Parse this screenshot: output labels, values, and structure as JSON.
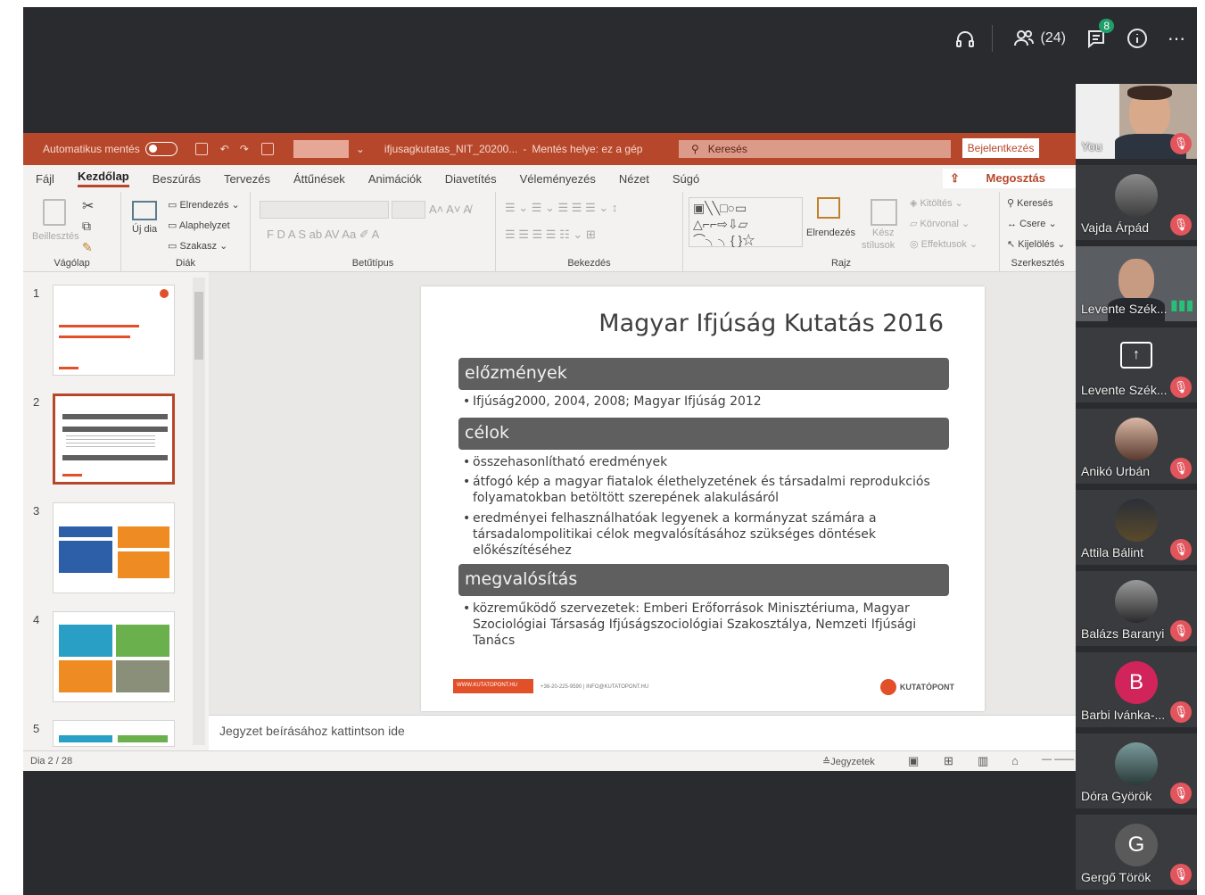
{
  "meeting": {
    "participants_count": "(24)",
    "chat_badge": "8"
  },
  "ppt": {
    "autosave_label": "Automatikus mentés",
    "file_title": "ifjusagkutatas_NIT_20200...",
    "save_location": "Mentés helye: ez a gép",
    "search_placeholder": "Keresés",
    "signin_label": "Bejelentkezés",
    "share_label": "Megosztás",
    "menu": [
      "Fájl",
      "Kezdőlap",
      "Beszúrás",
      "Tervezés",
      "Áttűnések",
      "Animációk",
      "Diavetítés",
      "Véleményezés",
      "Nézet",
      "Súgó"
    ],
    "ribbon": {
      "paste": "Beillesztés",
      "clipboard_group": "Vágólap",
      "new_slide": "Új dia",
      "layout": "Elrendezés",
      "reset": "Alaphelyzet",
      "section": "Szakasz",
      "slides_group": "Diák",
      "font_group": "Betűtípus",
      "paragraph_group": "Bekezdés",
      "arrange": "Elrendezés",
      "quick_styles_1": "Kész",
      "quick_styles_2": "stílusok",
      "fill": "Kitöltés",
      "outline": "Körvonal",
      "effects": "Effektusok",
      "drawing_group": "Rajz",
      "find": "Keresés",
      "replace": "Csere",
      "select": "Kijelölés",
      "editing_group": "Szerkesztés"
    },
    "thumb_numbers": [
      "1",
      "2",
      "3",
      "4",
      "5"
    ],
    "notes_placeholder": "Jegyzet beírásához kattintson ide",
    "status_slide": "Dia 2 / 28",
    "notes_button": "Jegyzetek"
  },
  "slide": {
    "title": "Magyar Ifjúság Kutatás 2016",
    "sections": [
      {
        "heading": "előzmények",
        "bullets": [
          "Ifjúság2000, 2004, 2008; Magyar Ifjúság 2012"
        ]
      },
      {
        "heading": "célok",
        "bullets": [
          "összehasonlítható eredmények",
          "átfogó kép a magyar fiatalok élethelyzetének és társadalmi reprodukciós folyamatokban betöltött szerepének alakulásáról",
          "eredményei felhasználhatóak legyenek a kormányzat számára a társadalompolitikai célok megvalósításához szükséges döntések előkészítéséhez"
        ]
      },
      {
        "heading": "megvalósítás",
        "bullets": [
          "közreműködő szervezetek: Emberi Erőforrások Minisztériuma, Magyar Szociológiai Társaság Ifjúságszociológiai Szakosztálya, Nemzeti Ifjúsági Tanács"
        ]
      }
    ],
    "footer_url": "WWW.KUTATOPONT.HU",
    "footer_contact": "+36-20-225-9590 | INFO@KUTATOPONT.HU",
    "logo_text": "KUTATÓPONT"
  },
  "participants": [
    {
      "name": "You",
      "type": "video"
    },
    {
      "name": "Vajda Árpád",
      "type": "photo"
    },
    {
      "name": "Levente Szék...",
      "type": "video"
    },
    {
      "name": "Levente Szék...",
      "type": "share"
    },
    {
      "name": "Anikó Urbán",
      "type": "photo"
    },
    {
      "name": "Attila Bálint",
      "type": "photo"
    },
    {
      "name": "Balázs Baranyi",
      "type": "photo"
    },
    {
      "name": "Barbi Ivánka-...",
      "type": "letter",
      "letter": "B",
      "color": "#d1245a"
    },
    {
      "name": "Dóra Györök",
      "type": "photo"
    },
    {
      "name": "Gergő Török",
      "type": "letter",
      "letter": "G",
      "color": "#5a5a5a"
    }
  ],
  "colors": {
    "accent": "#b7472a",
    "mute": "#e2555d"
  }
}
